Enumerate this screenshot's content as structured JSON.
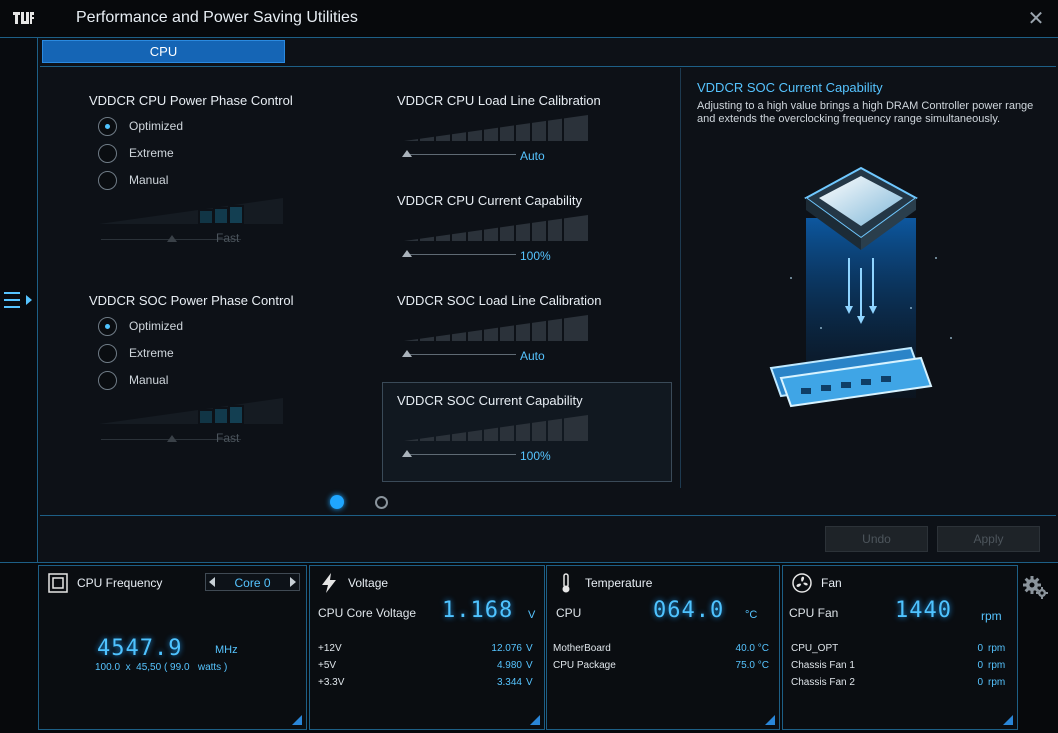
{
  "window": {
    "title": "Performance and Power Saving Utilities"
  },
  "tabs": [
    {
      "label": "CPU"
    }
  ],
  "left_column": {
    "cpu_phase": {
      "title": "VDDCR CPU Power Phase Control",
      "options": [
        "Optimized",
        "Extreme",
        "Manual"
      ],
      "selected": "Optimized",
      "slider_value": "Fast"
    },
    "soc_phase": {
      "title": "VDDCR SOC Power Phase Control",
      "options": [
        "Optimized",
        "Extreme",
        "Manual"
      ],
      "selected": "Optimized",
      "slider_value": "Fast"
    }
  },
  "middle_column": {
    "cpu_llc": {
      "title": "VDDCR CPU Load Line Calibration",
      "value": "Auto"
    },
    "cpu_cc": {
      "title": "VDDCR CPU Current Capability",
      "value": "100%"
    },
    "soc_llc": {
      "title": "VDDCR SOC Load Line Calibration",
      "value": "Auto"
    },
    "soc_cc": {
      "title": "VDDCR SOC Current Capability",
      "value": "100%"
    }
  },
  "info": {
    "title": "VDDCR SOC Current Capability",
    "description": "Adjusting to a high value brings a high DRAM Controller power range and extends the overclocking frequency range simultaneously."
  },
  "pagination": {
    "count": 2,
    "active": 1
  },
  "actions": {
    "undo": "Undo",
    "apply": "Apply"
  },
  "status": {
    "cpu_frequency": {
      "title": "CPU Frequency",
      "core": "Core 0",
      "value": "4547.9",
      "unit": "MHz",
      "detail": "100.0  x  45,50 ( 99.0   watts )"
    },
    "voltage": {
      "title": "Voltage",
      "main_label": "CPU Core Voltage",
      "main_value": "1.168",
      "main_unit": "V",
      "rows": [
        {
          "label": "+12V",
          "value": "12.076",
          "unit": "V"
        },
        {
          "label": "+5V",
          "value": "4.980",
          "unit": "V"
        },
        {
          "label": "+3.3V",
          "value": "3.344",
          "unit": "V"
        }
      ]
    },
    "temperature": {
      "title": "Temperature",
      "main_label": "CPU",
      "main_value": "064.0",
      "main_unit": "°C",
      "rows": [
        {
          "label": "MotherBoard",
          "value": "40.0 °C"
        },
        {
          "label": "CPU Package",
          "value": "75.0 °C"
        }
      ]
    },
    "fan": {
      "title": "Fan",
      "main_label": "CPU Fan",
      "main_value": "1440",
      "main_unit": "rpm",
      "rows": [
        {
          "label": "CPU_OPT",
          "value": "0",
          "unit": "rpm"
        },
        {
          "label": "Chassis Fan 1",
          "value": "0",
          "unit": "rpm"
        },
        {
          "label": "Chassis Fan 2",
          "value": "0",
          "unit": "rpm"
        }
      ]
    }
  },
  "colors": {
    "accent": "#4fc3ff",
    "tab": "#1565b5",
    "border": "#1d5f86"
  },
  "icons": [
    "tuf-logo-icon",
    "close-icon",
    "menu-expand-icon",
    "cpu-chip-icon",
    "lightning-icon",
    "thermometer-icon",
    "fan-icon",
    "gear-icon"
  ]
}
